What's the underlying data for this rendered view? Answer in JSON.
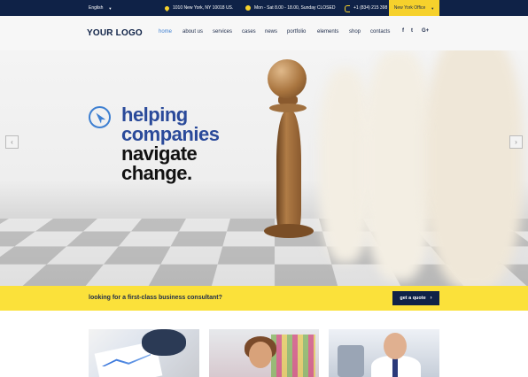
{
  "topbar": {
    "language": "English",
    "address": "1010 New York, NY 10018 US.",
    "hours": "Mon - Sat 8.00 - 18.00, Sunday CLOSED",
    "phone": "+1 (834) 215 398",
    "office": "New York Office"
  },
  "header": {
    "logo": "YOUR LOGO",
    "nav": [
      {
        "label": "home",
        "active": true
      },
      {
        "label": "about us"
      },
      {
        "label": "services"
      },
      {
        "label": "cases"
      },
      {
        "label": "news"
      },
      {
        "label": "portfolio"
      },
      {
        "label": "elements"
      },
      {
        "label": "shop"
      },
      {
        "label": "contacts"
      }
    ],
    "social": [
      "f",
      "t",
      "G+"
    ]
  },
  "hero": {
    "line1": "helping",
    "line2": "companies",
    "line3": "navigate",
    "line4": "change.",
    "prev": "‹",
    "next": "›"
  },
  "cta": {
    "text": "looking for a first-class business consultant?",
    "button": "get a quote",
    "button_icon": "›"
  },
  "colors": {
    "topbar_bg": "#0f2247",
    "accent_yellow": "#f6d12c",
    "cta_yellow": "#fbe13a",
    "link_blue": "#3d7fd1",
    "headline_blue": "#2a4a9a"
  }
}
